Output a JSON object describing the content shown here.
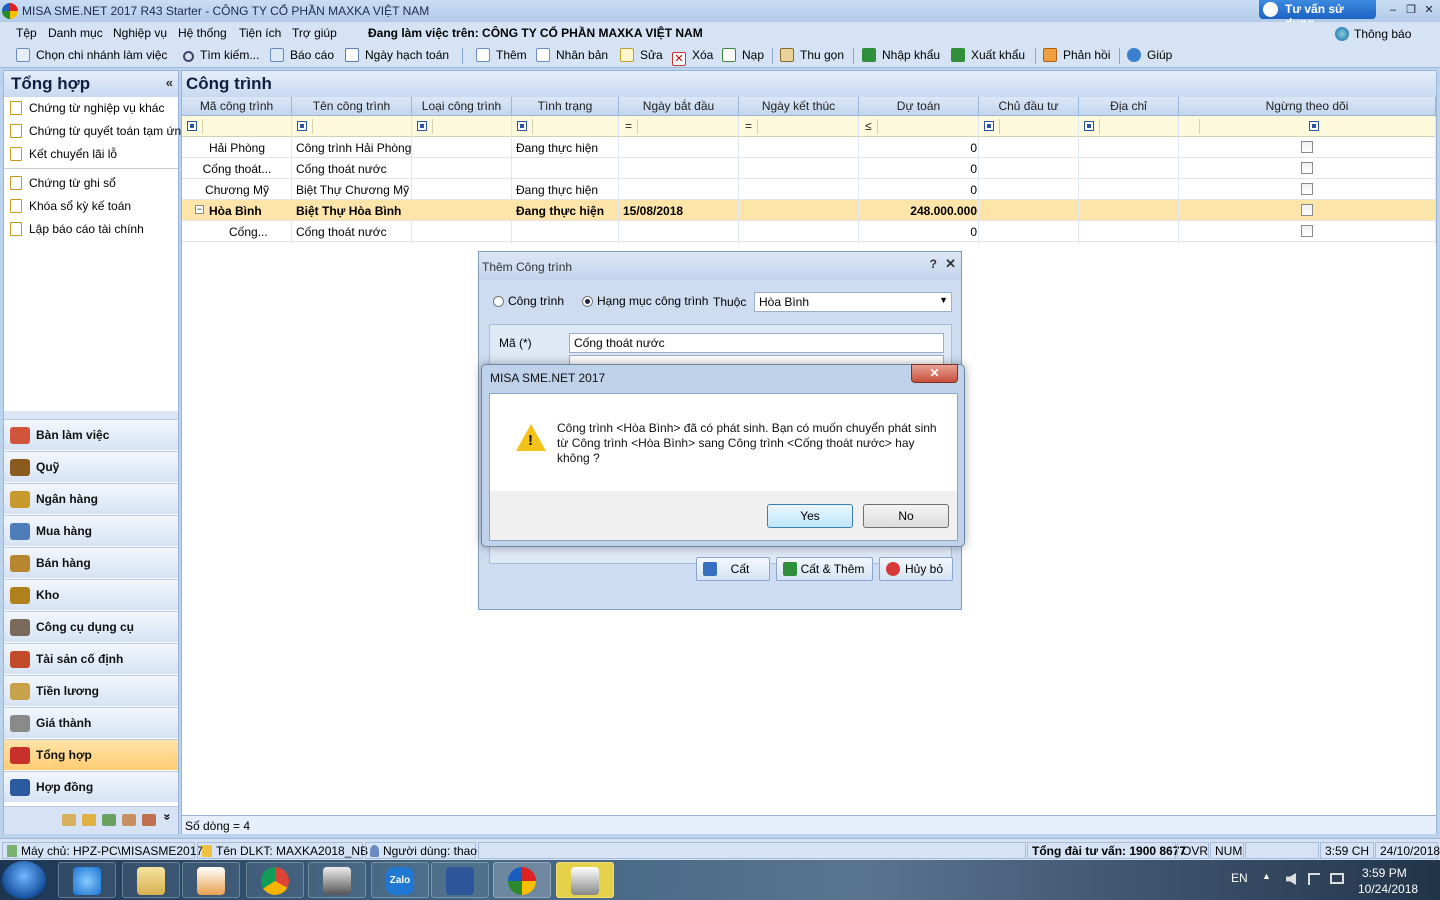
{
  "window": {
    "title": "MISA SME.NET 2017 R43 Starter - CÔNG TY CỔ PHẦN MAXKA VIỆT NAM",
    "tuvan": "Tư vấn sử dụng",
    "min": "–",
    "restore": "❐",
    "close": "✕"
  },
  "menu": {
    "items": [
      "Tệp",
      "Danh mục",
      "Nghiệp vụ",
      "Hệ thống",
      "Tiện ích",
      "Trợ giúp"
    ],
    "working_on": "Đang làm việc trên:  CÔNG TY CỔ PHẦN MAXKA VIỆT NAM",
    "notify": "Thông báo"
  },
  "toolbar": {
    "chon_chi_nhanh": "Chọn chi nhánh làm việc",
    "tim_kiem": "Tìm kiếm...",
    "bao_cao": "Báo cáo",
    "ngay_hach_toan": "Ngày hạch toán",
    "them": "Thêm",
    "nhan_ban": "Nhân bản",
    "sua": "Sửa",
    "xoa": "Xóa",
    "nap": "Nạp",
    "thu_gon": "Thu gọn",
    "nhap_khau": "Nhập khẩu",
    "xuat_khau": "Xuất khẩu",
    "phan_hoi": "Phản hồi",
    "giup": "Giúp"
  },
  "left": {
    "title": "Tổng hợp",
    "collapse": "«",
    "items": [
      "Chứng từ nghiệp vụ khác",
      "Chứng từ quyết toán tạm ứn...",
      "Kết chuyển lãi lỗ",
      "Chứng từ ghi sổ",
      "Khóa sổ kỳ kế toán",
      "Lập báo cáo tài chính"
    ],
    "nav": [
      {
        "label": "Bàn làm việc",
        "color": "#d0553a"
      },
      {
        "label": "Quỹ",
        "color": "#8a5a1e"
      },
      {
        "label": "Ngân hàng",
        "color": "#c89a2e"
      },
      {
        "label": "Mua hàng",
        "color": "#4d7cb8"
      },
      {
        "label": "Bán hàng",
        "color": "#b8862e"
      },
      {
        "label": "Kho",
        "color": "#b0801c"
      },
      {
        "label": "Công cụ dụng cụ",
        "color": "#7a6a5a"
      },
      {
        "label": "Tài sản cố định",
        "color": "#c24b2a"
      },
      {
        "label": "Tiền lương",
        "color": "#c8a24a"
      },
      {
        "label": "Giá thành",
        "color": "#8a8a8a"
      },
      {
        "label": "Tổng hợp",
        "color": "#c8302a",
        "active": true
      },
      {
        "label": "Hợp đồng",
        "color": "#2a5aa0"
      }
    ],
    "more": "»"
  },
  "main": {
    "title": "Công trình",
    "columns": [
      "Mã công trình",
      "Tên công trình",
      "Loại công trình",
      "Tình trạng",
      "Ngày bắt đầu",
      "Ngày kết thúc",
      "Dự toán",
      "Chủ đầu tư",
      "Địa chỉ",
      "Ngừng theo dõi"
    ],
    "filter_ops": [
      "=",
      "=",
      "≤"
    ],
    "rows": [
      {
        "ma": "Hải Phòng",
        "ten": "Công trình Hải Phòng",
        "loai": "",
        "tinh_trang": "Đang thực hiện",
        "bd": "",
        "kt": "",
        "du_toan": "0"
      },
      {
        "ma": "Cống thoát...",
        "ten": "Cống thoát nước",
        "loai": "",
        "tinh_trang": "",
        "bd": "",
        "kt": "",
        "du_toan": "0"
      },
      {
        "ma": "Chương Mỹ",
        "ten": "Biệt Thự Chương Mỹ",
        "loai": "",
        "tinh_trang": "Đang thực hiện",
        "bd": "",
        "kt": "",
        "du_toan": "0"
      },
      {
        "ma": "Hòa Bình",
        "ten": "Biệt Thự Hòa Bình",
        "loai": "",
        "tinh_trang": "Đang thực hiện",
        "bd": "15/08/2018",
        "kt": "",
        "du_toan": "248.000.000",
        "selected": true,
        "expand": "−"
      },
      {
        "ma": "Cống...",
        "ten": "Cống thoát nước",
        "loai": "",
        "tinh_trang": "",
        "bd": "",
        "kt": "",
        "du_toan": "0"
      }
    ],
    "row_count": "Số dòng = 4"
  },
  "dialog_add": {
    "title": "Thêm Công trình",
    "help": "?",
    "close": "✕",
    "radio1": "Công trình",
    "radio2": "Hạng mục công trình",
    "thuoc_label": "Thuộc",
    "thuoc_value": "Hòa Bình",
    "ma_label": "Mã (*)",
    "ma_value": "Cống thoát nước",
    "btn_cat": "Cất",
    "btn_cat_them": "Cất & Thêm",
    "btn_huy": "Hủy bỏ"
  },
  "msgbox": {
    "title": "MISA SME.NET 2017",
    "message": "Công trình <Hòa Bình> đã có phát sinh. Bạn có muốn chuyển phát sinh từ Công trình <Hòa Bình> sang Công trình <Cống thoát nước> hay không ?",
    "yes": "Yes",
    "no": "No",
    "close": "✕"
  },
  "status": {
    "server": "Máy chủ: HPZ-PC\\MISASME2017",
    "db": "Tên DLKT: MAXKA2018_NB",
    "user": "Người dùng: thao",
    "hotline": "Tổng đài tư vấn: 1900 8677",
    "ovr": "OVR",
    "num": "NUM",
    "time": "3:59 CH",
    "date": "24/10/2018"
  },
  "taskbar": {
    "lang": "EN",
    "clock_time": "3:59 PM",
    "clock_date": "10/24/2018",
    "zalo": "Zalo"
  }
}
